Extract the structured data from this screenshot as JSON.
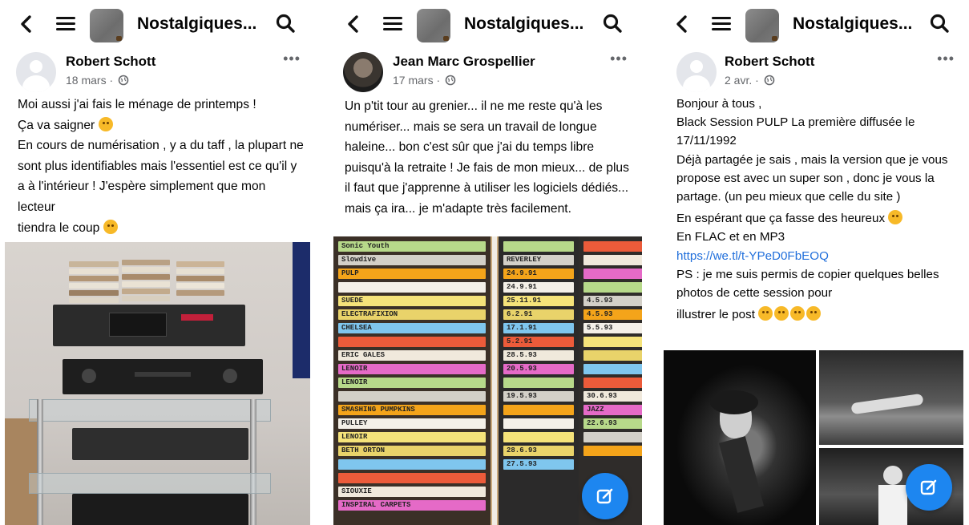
{
  "group_title": "Nostalgiques...",
  "panels": [
    {
      "author": "Robert Schott",
      "date": "18 mars ·",
      "paragraphs": [
        "Moi aussi j'ai fais le ménage de printemps !",
        "Ça va saigner",
        "En cours de numérisation , y a du taff , la plupart ne sont plus identifiables mais l'essentiel est ce qu'il y a à l'intérieur ! J'espère simplement que mon lecteur",
        "tiendra le coup"
      ],
      "photo": "hifi stack with cassette tapes"
    },
    {
      "author": "Jean Marc Grospellier",
      "date": "17 mars ·",
      "paragraphs": [
        "Un p'tit tour au grenier... il ne me reste qu'à les numériser... mais se sera un travail de longue haleine... bon c'est sûr que j'ai du temps libre puisqu'à la retraite ! Je fais de mon mieux... de plus il faut que j'apprenne à utiliser les logiciels dédiés... mais ça ira... je m'adapte très facilement."
      ],
      "tape_labels_left": [
        "Sonic Youth",
        "Slowdive",
        "PULP",
        "",
        "SUEDE",
        "ELECTRAFIXION",
        "CHELSEA",
        "",
        "ERIC GALES",
        "LENOIR",
        "LENOIR",
        "",
        "SMASHING PUMPKINS",
        "PULLEY",
        "LENOIR",
        "BETH ORTON",
        "",
        "",
        "SIOUXIE",
        "INSPIRAL CARPETS"
      ],
      "tape_labels_right": [
        "",
        "REVERLEY",
        "24.9.91",
        "24.9.91",
        "25.11.91",
        "6.2.91",
        "17.1.91",
        "5.2.91",
        "28.5.93",
        "20.5.93",
        "",
        "19.5.93",
        "",
        "",
        "",
        "28.6.93",
        "27.5.93"
      ],
      "tape_labels_right2": [
        "",
        "",
        "",
        "",
        "4.5.93",
        "4.5.93",
        "5.5.93",
        "",
        "",
        "",
        "",
        "30.6.93",
        "JAZZ",
        "22.6.93",
        "",
        ""
      ]
    },
    {
      "author": "Robert Schott",
      "date": "2 avr. ·",
      "paragraphs": [
        "Bonjour à tous ,",
        "Black Session PULP La première diffusée le 17/11/1992",
        "Déjà partagée je sais , mais la version que je vous propose est avec un super son , donc je vous la partage. (un peu mieux que celle du site )",
        "En espérant que ça fasse des heureux",
        "En FLAC et en MP3",
        "https://we.tl/t-YPeD0FbEOQ",
        "PS : je me suis permis de copier quelques belles photos de cette session pour",
        "illustrer le post"
      ]
    }
  ],
  "colors": {
    "link": "#216fdb",
    "fab": "#1d86f0",
    "meta": "#65676b"
  },
  "icons": [
    "back-arrow-icon",
    "menu-icon",
    "search-icon",
    "more-options-icon",
    "globe-icon",
    "compose-icon"
  ]
}
